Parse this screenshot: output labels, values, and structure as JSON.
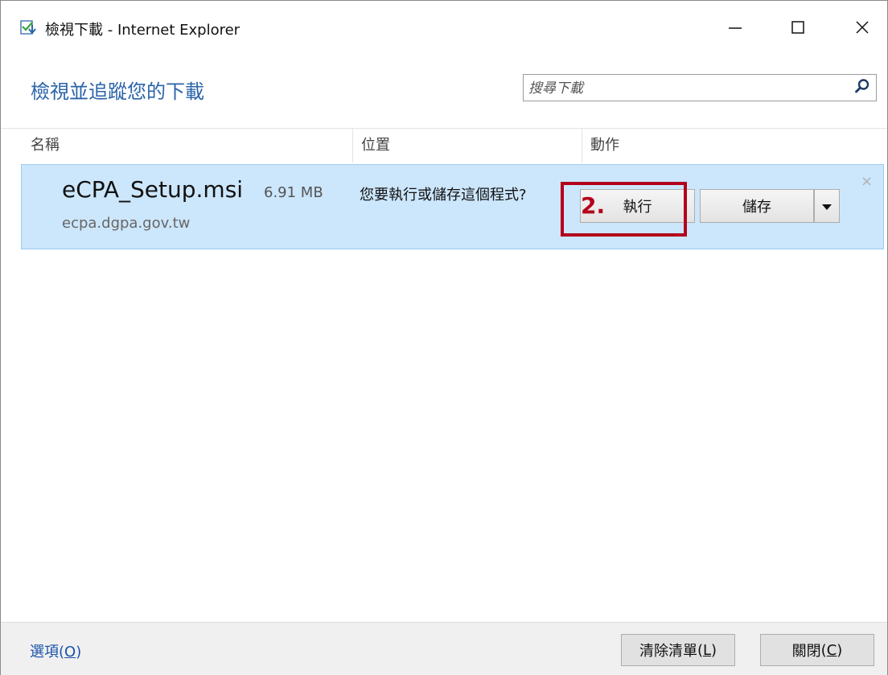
{
  "window": {
    "title": "檢視下載 - Internet Explorer",
    "icons": {
      "app": "download-manager-icon",
      "minimize": "minimize-icon",
      "maximize": "maximize-icon",
      "close": "close-icon"
    }
  },
  "header": {
    "title": "檢視並追蹤您的下載",
    "search": {
      "placeholder": "搜尋下載",
      "icon": "search-icon"
    }
  },
  "columns": [
    "名稱",
    "位置",
    "動作"
  ],
  "downloads": [
    {
      "file_name": "eCPA_Setup.msi",
      "size": "6.91 MB",
      "domain": "ecpa.dgpa.gov.tw",
      "prompt": "您要執行或儲存這個程式?",
      "run_label": "執行",
      "save_label": "儲存",
      "dropdown_icon": "caret-down-icon",
      "dismiss_label": "×"
    }
  ],
  "annotation": {
    "label": "2.",
    "color": "#b3001b"
  },
  "footer": {
    "options_label": "選項",
    "options_key": "O",
    "clear_label": "清除清單",
    "clear_key": "L",
    "close_label": "關閉",
    "close_key": "C"
  },
  "colors": {
    "accent": "#2a64a8",
    "row_selected": "#cce6fb",
    "annotation": "#b3001b",
    "link": "#1a52a8"
  }
}
